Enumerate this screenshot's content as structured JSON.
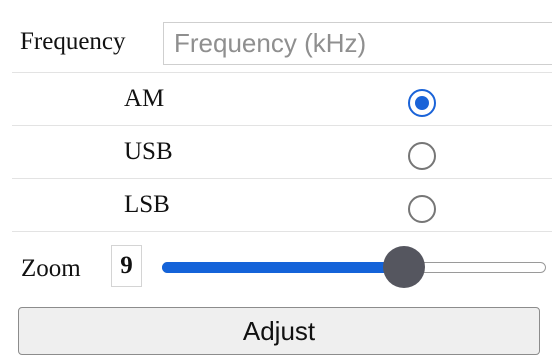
{
  "frequency": {
    "label": "Frequency",
    "value": "",
    "placeholder": "Frequency (kHz)"
  },
  "modes": [
    {
      "label": "AM",
      "checked": true
    },
    {
      "label": "USB",
      "checked": false
    },
    {
      "label": "LSB",
      "checked": false
    }
  ],
  "zoom": {
    "label": "Zoom",
    "value": "9",
    "slider_fraction": 0.63
  },
  "adjust_label": "Adjust",
  "colors": {
    "accent": "#1a63d8",
    "slider_thumb": "#55565f",
    "button_bg": "#efefef"
  }
}
